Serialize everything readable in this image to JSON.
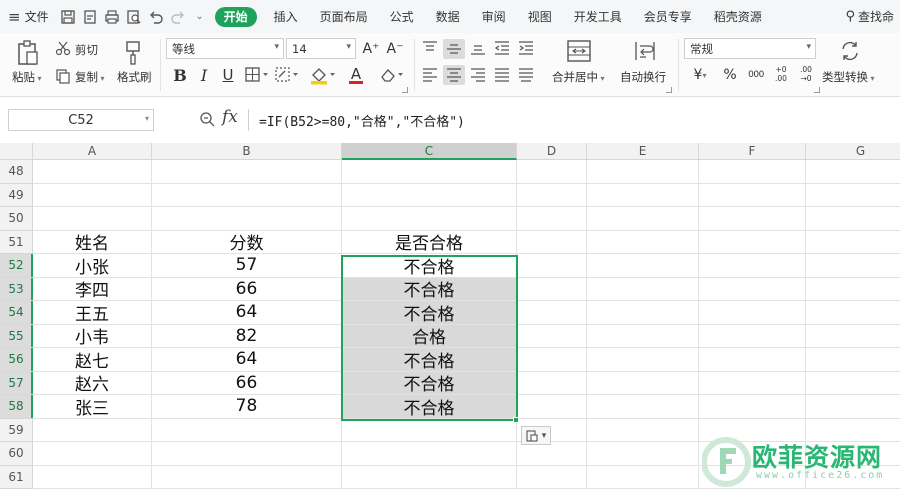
{
  "menubar": {
    "hamburger": "≡",
    "file_label": "文件",
    "tabs": [
      "开始",
      "插入",
      "页面布局",
      "公式",
      "数据",
      "审阅",
      "视图",
      "开发工具",
      "会员专享",
      "稻壳资源"
    ],
    "search_label": "查找命"
  },
  "ribbon": {
    "clipboard": {
      "paste": "粘贴",
      "cut": "剪切",
      "copy": "复制",
      "format_painter": "格式刷"
    },
    "font": {
      "name": "等线",
      "size": "14",
      "bold": "B",
      "italic": "I",
      "underline": "U",
      "font_color_letter": "A",
      "grow": "A⁺",
      "shrink": "A⁻"
    },
    "alignment": {
      "merge_center": "合并居中",
      "wrap_text": "自动换行"
    },
    "number": {
      "format": "常规",
      "currency": "¥",
      "percent": "%",
      "thousands": "000",
      "inc_decimal": "+0 .00",
      "dec_decimal": ".00 →0",
      "convert": "类型转换"
    },
    "colors": {
      "font_color": "#e02020",
      "fill_color": "#f5d000",
      "accent": "#1fa35c"
    }
  },
  "formula_bar": {
    "name_box": "C52",
    "fx": "fx",
    "formula": "=IF(B52>=80,\"合格\",\"不合格\")"
  },
  "grid": {
    "columns": [
      "A",
      "B",
      "C",
      "D",
      "E",
      "F",
      "G"
    ],
    "selected_column": "C",
    "row_numbers": [
      "48",
      "49",
      "50",
      "51",
      "52",
      "53",
      "54",
      "55",
      "56",
      "57",
      "58",
      "59",
      "60",
      "61"
    ],
    "selected_rows": [
      "52",
      "53",
      "54",
      "55",
      "56",
      "57",
      "58"
    ],
    "cells": {
      "r51": {
        "a": "姓名",
        "b": "分数",
        "c": "是否合格"
      },
      "data": [
        {
          "row": "52",
          "name": "小张",
          "score": "57",
          "result": "不合格"
        },
        {
          "row": "53",
          "name": "李四",
          "score": "66",
          "result": "不合格"
        },
        {
          "row": "54",
          "name": "王五",
          "score": "64",
          "result": "不合格"
        },
        {
          "row": "55",
          "name": "小韦",
          "score": "82",
          "result": "合格"
        },
        {
          "row": "56",
          "name": "赵七",
          "score": "64",
          "result": "不合格"
        },
        {
          "row": "57",
          "name": "赵六",
          "score": "66",
          "result": "不合格"
        },
        {
          "row": "58",
          "name": "张三",
          "score": "78",
          "result": "不合格"
        }
      ]
    }
  },
  "watermark": {
    "text": "欧菲资源网",
    "url": "www.office26.com"
  }
}
